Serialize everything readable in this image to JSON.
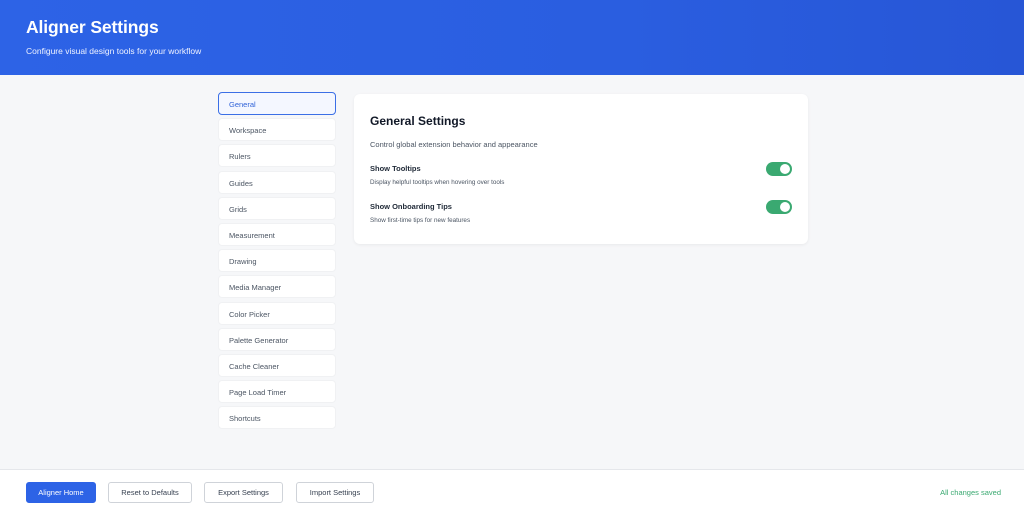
{
  "header": {
    "title": "Aligner Settings",
    "subtitle": "Configure visual design tools for your workflow"
  },
  "sidebar": {
    "items": [
      {
        "label": "General",
        "active": true
      },
      {
        "label": "Workspace"
      },
      {
        "label": "Rulers"
      },
      {
        "label": "Guides"
      },
      {
        "label": "Grids"
      },
      {
        "label": "Measurement"
      },
      {
        "label": "Drawing"
      },
      {
        "label": "Media Manager"
      },
      {
        "label": "Color Picker"
      },
      {
        "label": "Palette Generator"
      },
      {
        "label": "Cache Cleaner"
      },
      {
        "label": "Page Load Timer"
      },
      {
        "label": "Shortcuts"
      }
    ]
  },
  "panel": {
    "title": "General Settings",
    "description": "Control global extension behavior and appearance",
    "settings": [
      {
        "label": "Show Tooltips",
        "help": "Display helpful tooltips when hovering over tools",
        "enabled": true
      },
      {
        "label": "Show Onboarding Tips",
        "help": "Show first-time tips for new features",
        "enabled": true
      }
    ]
  },
  "footer": {
    "home_label": "Aligner Home",
    "reset_label": "Reset to Defaults",
    "export_label": "Export Settings",
    "import_label": "Import Settings",
    "status": "All changes saved"
  },
  "colors": {
    "accent": "#2d63e6",
    "success": "#3aa971"
  }
}
